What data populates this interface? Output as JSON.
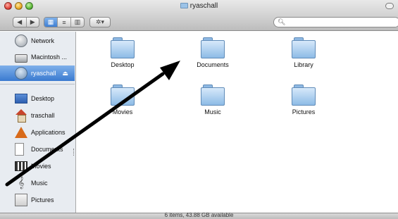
{
  "window": {
    "title": "ryaschall"
  },
  "toolbar": {
    "back_label": "◀",
    "forward_label": "▶",
    "view_icons_label": "▦",
    "view_list_label": "≡",
    "view_columns_label": "▥",
    "action_label": "✲▾",
    "search_placeholder": ""
  },
  "sidebar": {
    "items": [
      {
        "label": "Network",
        "icon": "network-icon"
      },
      {
        "label": "Macintosh ...",
        "icon": "hard-drive-icon"
      },
      {
        "label": "ryaschall",
        "icon": "user-disk-icon",
        "selected": true
      },
      {
        "label": "Desktop",
        "icon": "desktop-icon"
      },
      {
        "label": "traschall",
        "icon": "home-icon"
      },
      {
        "label": "Applications",
        "icon": "applications-icon"
      },
      {
        "label": "Documents",
        "icon": "documents-icon"
      },
      {
        "label": "Movies",
        "icon": "movies-icon"
      },
      {
        "label": "Music",
        "icon": "music-icon"
      },
      {
        "label": "Pictures",
        "icon": "pictures-icon"
      }
    ]
  },
  "content": {
    "items": [
      {
        "label": "Desktop"
      },
      {
        "label": "Documents"
      },
      {
        "label": "Library"
      },
      {
        "label": "Movies"
      },
      {
        "label": "Music"
      },
      {
        "label": "Pictures"
      }
    ]
  },
  "status": {
    "text": "6 items, 43.88 GB available"
  },
  "colors": {
    "selection": "#3a7ad0",
    "folder": "#8dbbe6",
    "arrow": "#000000"
  }
}
